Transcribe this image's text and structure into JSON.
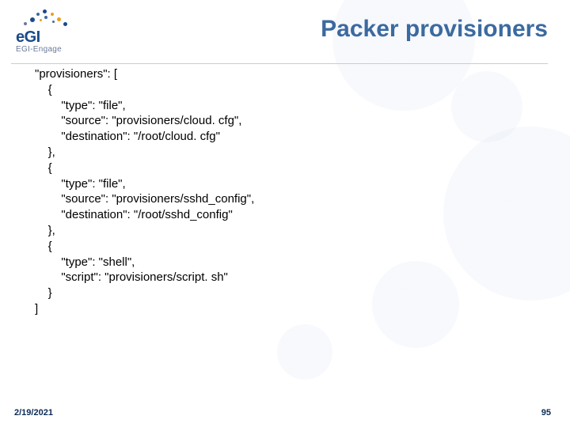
{
  "brand": {
    "name": "eGI",
    "sub": "EGI-Engage"
  },
  "title": "Packer provisioners",
  "footer": {
    "date": "2/19/2021",
    "page": "95"
  },
  "code": {
    "l1": "\"provisioners\": [",
    "l2": "    {",
    "l3": "        \"type\": \"file\",",
    "l4": "        \"source\": \"provisioners/cloud. cfg\",",
    "l5": "        \"destination\": \"/root/cloud. cfg\"",
    "l6": "    },",
    "l7": "    {",
    "l8": "        \"type\": \"file\",",
    "l9": "        \"source\": \"provisioners/sshd_config\",",
    "l10": "        \"destination\": \"/root/sshd_config\"",
    "l11": "    },",
    "l12": "    {",
    "l13": "        \"type\": \"shell\",",
    "l14": "        \"script\": \"provisioners/script. sh\"",
    "l15": "    }",
    "l16": "]"
  }
}
